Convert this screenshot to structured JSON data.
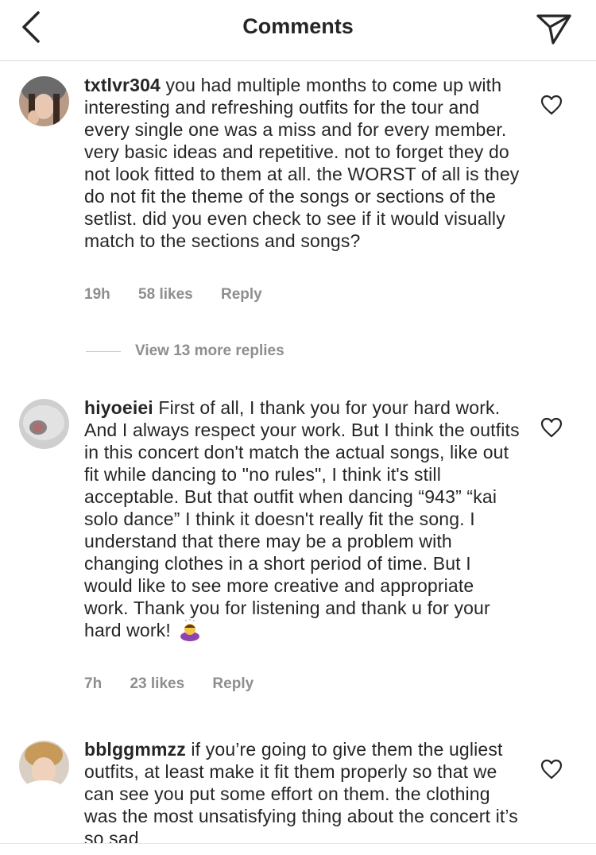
{
  "header": {
    "title": "Comments",
    "back_icon": "chevron-left-icon",
    "share_icon": "send-icon"
  },
  "comments": [
    {
      "username": "txtlvr304",
      "text": "you had multiple months to come up with interesting and refreshing outfits for the tour and every single one was a miss and for every member. very basic ideas and repetitive. not to forget they do not look fitted to them at all.  the WORST of all is they do not fit the theme of the songs or sections of the setlist. did you even check to see if it would visually match to the sections and songs?",
      "time": "19h",
      "likes": "58 likes",
      "reply": "Reply"
    },
    {
      "username": "hiyoeiei",
      "text": "First of all, I thank you for your hard work.  And I always respect your work.  But I think the outfits in this concert don't match the actual songs, like out fit while dancing to \"no rules\", I think it's still acceptable.  But that outfit when dancing “943” “kai solo dance” I think it doesn't really fit the song.  I understand that there may be a problem with changing clothes in a short period of time.  But I would like to see more creative and appropriate work.  Thank you for listening and thank u for your hard work!",
      "emoji": "bowing-person-emoji",
      "time": "7h",
      "likes": "23 likes",
      "reply": "Reply"
    },
    {
      "username": "bblggmmzz",
      "text": "if you’re going to give them the ugliest outfits, at least make it fit them properly so that we can see you put some effort on them. the clothing was the most unsatisfying thing about the concert it’s so sad"
    }
  ],
  "view_replies": {
    "label": "View 13 more replies"
  },
  "colors": {
    "text": "#262626",
    "secondary": "#8e8e8e",
    "divider": "#dbdbdb"
  }
}
